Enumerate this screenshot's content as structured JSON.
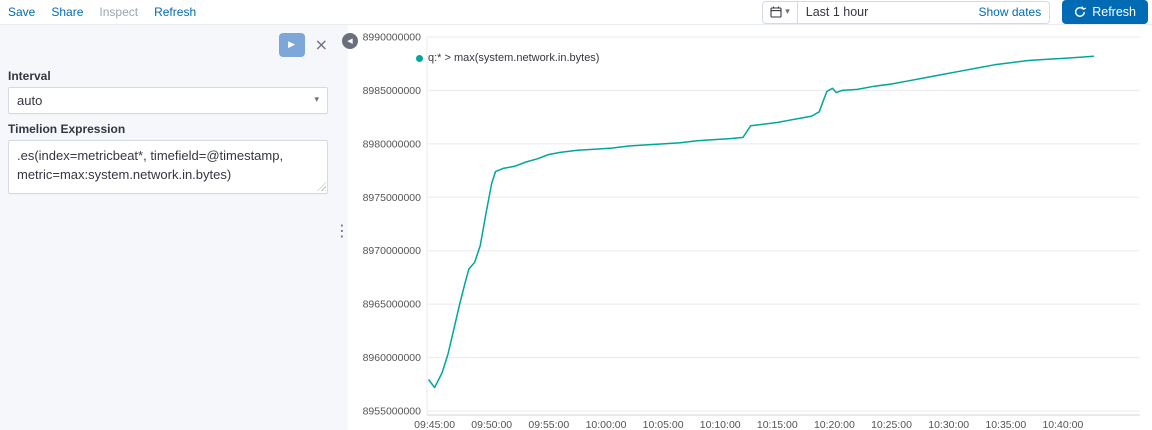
{
  "toolbar": {
    "save": "Save",
    "share": "Share",
    "inspect": "Inspect",
    "refresh": "Refresh"
  },
  "datepicker": {
    "value": "Last 1 hour",
    "show_dates": "Show dates",
    "refresh_label": "Refresh"
  },
  "sidebar": {
    "interval_label": "Interval",
    "interval_value": "auto",
    "expression_label": "Timelion Expression",
    "expression_value": ".es(index=metricbeat*, timefield=@timestamp, metric=max:system.network.in.bytes)"
  },
  "icons": {
    "play": "▶",
    "close": "×",
    "chevron_down": "▾",
    "collapse": "◀",
    "drag_handle": "⋮"
  },
  "colors": {
    "accent_blue": "#006bb4",
    "panel_bg": "#f5f7fa"
  },
  "chart_data": {
    "type": "line",
    "legend": "q:* > max(system.network.in.bytes)",
    "line_color": "#00a69b",
    "grid": true,
    "legend_position": "top-left",
    "ylabel": "",
    "xlabel": "",
    "ylim": [
      8955000000,
      8990000000
    ],
    "xlim": [
      "09:44:20",
      "10:46:45"
    ],
    "y_ticks": [
      8955000000,
      8960000000,
      8965000000,
      8970000000,
      8975000000,
      8980000000,
      8985000000,
      8990000000
    ],
    "x_ticks": [
      "09:45:00",
      "09:50:00",
      "09:55:00",
      "10:00:00",
      "10:05:00",
      "10:10:00",
      "10:15:00",
      "10:20:00",
      "10:25:00",
      "10:30:00",
      "10:35:00",
      "10:40:00"
    ],
    "points": [
      [
        "09:44:30",
        8957900000
      ],
      [
        "09:45:00",
        8957200000
      ],
      [
        "09:45:40",
        8958600000
      ],
      [
        "09:46:10",
        8960300000
      ],
      [
        "09:46:40",
        8962600000
      ],
      [
        "09:47:10",
        8964900000
      ],
      [
        "09:47:40",
        8967000000
      ],
      [
        "09:48:00",
        8968300000
      ],
      [
        "09:48:30",
        8968900000
      ],
      [
        "09:49:00",
        8970500000
      ],
      [
        "09:49:30",
        8973500000
      ],
      [
        "09:50:00",
        8976300000
      ],
      [
        "09:50:20",
        8977400000
      ],
      [
        "09:51:00",
        8977700000
      ],
      [
        "09:52:00",
        8977900000
      ],
      [
        "09:53:00",
        8978300000
      ],
      [
        "09:54:00",
        8978600000
      ],
      [
        "09:55:00",
        8979000000
      ],
      [
        "09:56:00",
        8979200000
      ],
      [
        "09:57:30",
        8979400000
      ],
      [
        "09:59:00",
        8979500000
      ],
      [
        "10:00:30",
        8979600000
      ],
      [
        "10:02:00",
        8979800000
      ],
      [
        "10:03:30",
        8979900000
      ],
      [
        "10:05:00",
        8980000000
      ],
      [
        "10:06:30",
        8980100000
      ],
      [
        "10:08:00",
        8980300000
      ],
      [
        "10:09:30",
        8980400000
      ],
      [
        "10:11:00",
        8980500000
      ],
      [
        "10:12:00",
        8980600000
      ],
      [
        "10:12:40",
        8981700000
      ],
      [
        "10:13:30",
        8981800000
      ],
      [
        "10:15:00",
        8982000000
      ],
      [
        "10:16:00",
        8982200000
      ],
      [
        "10:17:00",
        8982400000
      ],
      [
        "10:18:00",
        8982600000
      ],
      [
        "10:18:40",
        8983000000
      ],
      [
        "10:19:20",
        8984900000
      ],
      [
        "10:19:50",
        8985200000
      ],
      [
        "10:20:10",
        8984800000
      ],
      [
        "10:20:40",
        8985000000
      ],
      [
        "10:22:00",
        8985100000
      ],
      [
        "10:23:30",
        8985400000
      ],
      [
        "10:25:00",
        8985600000
      ],
      [
        "10:26:30",
        8985900000
      ],
      [
        "10:28:00",
        8986200000
      ],
      [
        "10:29:30",
        8986500000
      ],
      [
        "10:31:00",
        8986800000
      ],
      [
        "10:32:30",
        8987100000
      ],
      [
        "10:34:00",
        8987400000
      ],
      [
        "10:35:30",
        8987600000
      ],
      [
        "10:37:00",
        8987800000
      ],
      [
        "10:38:30",
        8987900000
      ],
      [
        "10:40:00",
        8988000000
      ],
      [
        "10:41:30",
        8988100000
      ],
      [
        "10:42:40",
        8988200000
      ]
    ]
  }
}
